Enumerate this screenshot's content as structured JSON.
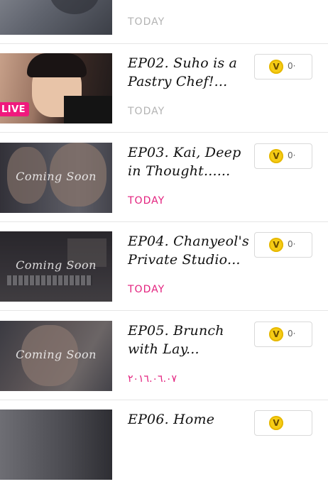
{
  "episodes": [
    {
      "title": "",
      "date": "TODAY",
      "date_style": "gray",
      "coin_label": "V",
      "coin_count": "",
      "live": false,
      "coming_soon": false
    },
    {
      "title": "EP02. Suho is a Pastry Chef!...",
      "date": "TODAY",
      "date_style": "gray",
      "coin_label": "V",
      "coin_count": "0·",
      "live": true,
      "live_label": "LIVE",
      "coming_soon": false
    },
    {
      "title": "EP03. Kai, Deep in Thought......",
      "date": "TODAY",
      "date_style": "pink",
      "coin_label": "V",
      "coin_count": "0·",
      "live": false,
      "coming_soon": true,
      "coming_label": "Coming Soon"
    },
    {
      "title": "EP04. Chanyeol's Private Studio...",
      "date": "TODAY",
      "date_style": "pink",
      "coin_label": "V",
      "coin_count": "0·",
      "live": false,
      "coming_soon": true,
      "coming_label": "Coming Soon"
    },
    {
      "title": "EP05. Brunch with Lay...",
      "date": "٢٠١٦.٠٦.٠٧",
      "date_style": "pink",
      "coin_label": "V",
      "coin_count": "0·",
      "live": false,
      "coming_soon": true,
      "coming_label": "Coming Soon"
    },
    {
      "title": "EP06. Home",
      "date": "",
      "date_style": "pink",
      "coin_label": "V",
      "coin_count": "",
      "live": false,
      "coming_soon": false
    }
  ],
  "colors": {
    "accent_pink": "#e3217e",
    "live_badge": "#f0197d",
    "coin": "#f6cc15"
  }
}
